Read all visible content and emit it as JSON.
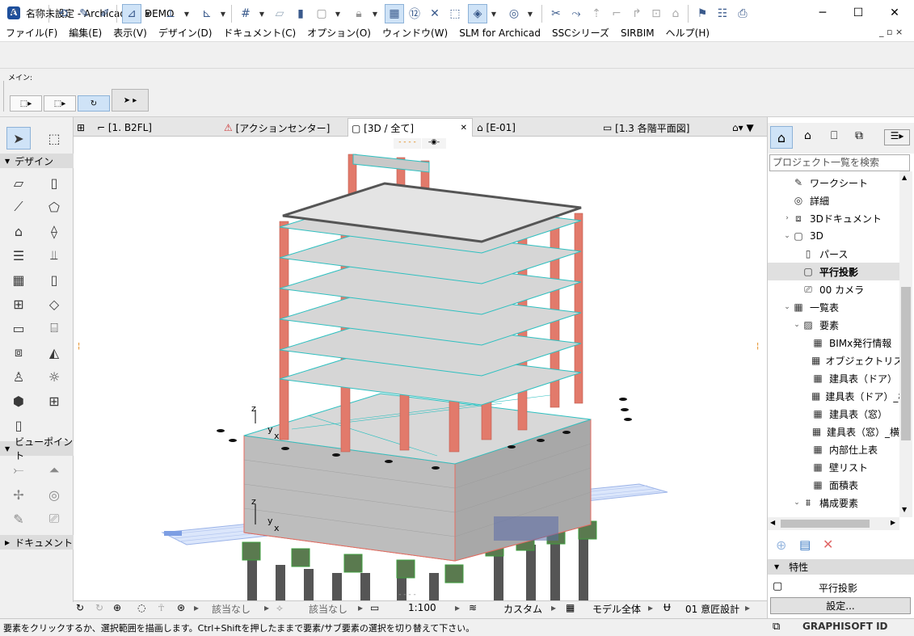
{
  "window": {
    "title": "名称未設定 - Archicad 26 DEMO",
    "minimize": "─",
    "maximize": "☐",
    "close": "✕"
  },
  "menu": [
    "ファイル(F)",
    "編集(E)",
    "表示(V)",
    "デザイン(D)",
    "ドキュメント(C)",
    "オプション(O)",
    "ウィンドウ(W)",
    "SLM for Archicad",
    "SSCシリーズ",
    "SIRBIM",
    "ヘルプ(H)"
  ],
  "mdi_controls": "_ ▫ ×",
  "infobox": {
    "label": "メイン:"
  },
  "toolbox": {
    "design_section": "デザイン",
    "viewpoint_section": "ビューポイント",
    "document_section": "ドキュメント"
  },
  "tabs": [
    {
      "label": "[1. B2FL]"
    },
    {
      "label": "[アクションセンター]"
    },
    {
      "label": "[3D / 全て]"
    },
    {
      "label": "[E-01]"
    },
    {
      "label": "[1.3 各階平面図]"
    }
  ],
  "tab_close": "✕",
  "viewport": {
    "axis_z": "z",
    "axis_y": "y",
    "axis_x": "x"
  },
  "navbar": {
    "none1": "該当なし",
    "none2": "該当なし",
    "scale": "1:100",
    "custom": "カスタム",
    "model": "モデル全体",
    "layer": "01 意匠設計"
  },
  "status": {
    "text": "要素をクリックするか、選択範囲を描画します。Ctrl+Shiftを押したままで要素/サブ要素の選択を切り替えて下さい。",
    "graphisoft_id": "GRAPHISOFT ID"
  },
  "navigator": {
    "search_placeholder": "プロジェクト一覧を検索",
    "items": [
      {
        "label": "ワークシート"
      },
      {
        "label": "詳細"
      },
      {
        "label": "3Dドキュメント"
      },
      {
        "label": "3D"
      },
      {
        "label": "パース"
      },
      {
        "label": "平行投影"
      },
      {
        "label": "00 カメラ"
      },
      {
        "label": "一覧表"
      },
      {
        "label": "要素"
      },
      {
        "label": "BIMx発行情報"
      },
      {
        "label": "オブジェクトリスト"
      },
      {
        "label": "建具表（ドア）"
      },
      {
        "label": "建具表（ドア）_横"
      },
      {
        "label": "建具表（窓）"
      },
      {
        "label": "建具表（窓）_横"
      },
      {
        "label": "内部仕上表"
      },
      {
        "label": "壁リスト"
      },
      {
        "label": "面積表"
      },
      {
        "label": "構成要素"
      }
    ]
  },
  "properties": {
    "header": "特性",
    "view_name": "平行投影",
    "settings_button": "設定..."
  }
}
